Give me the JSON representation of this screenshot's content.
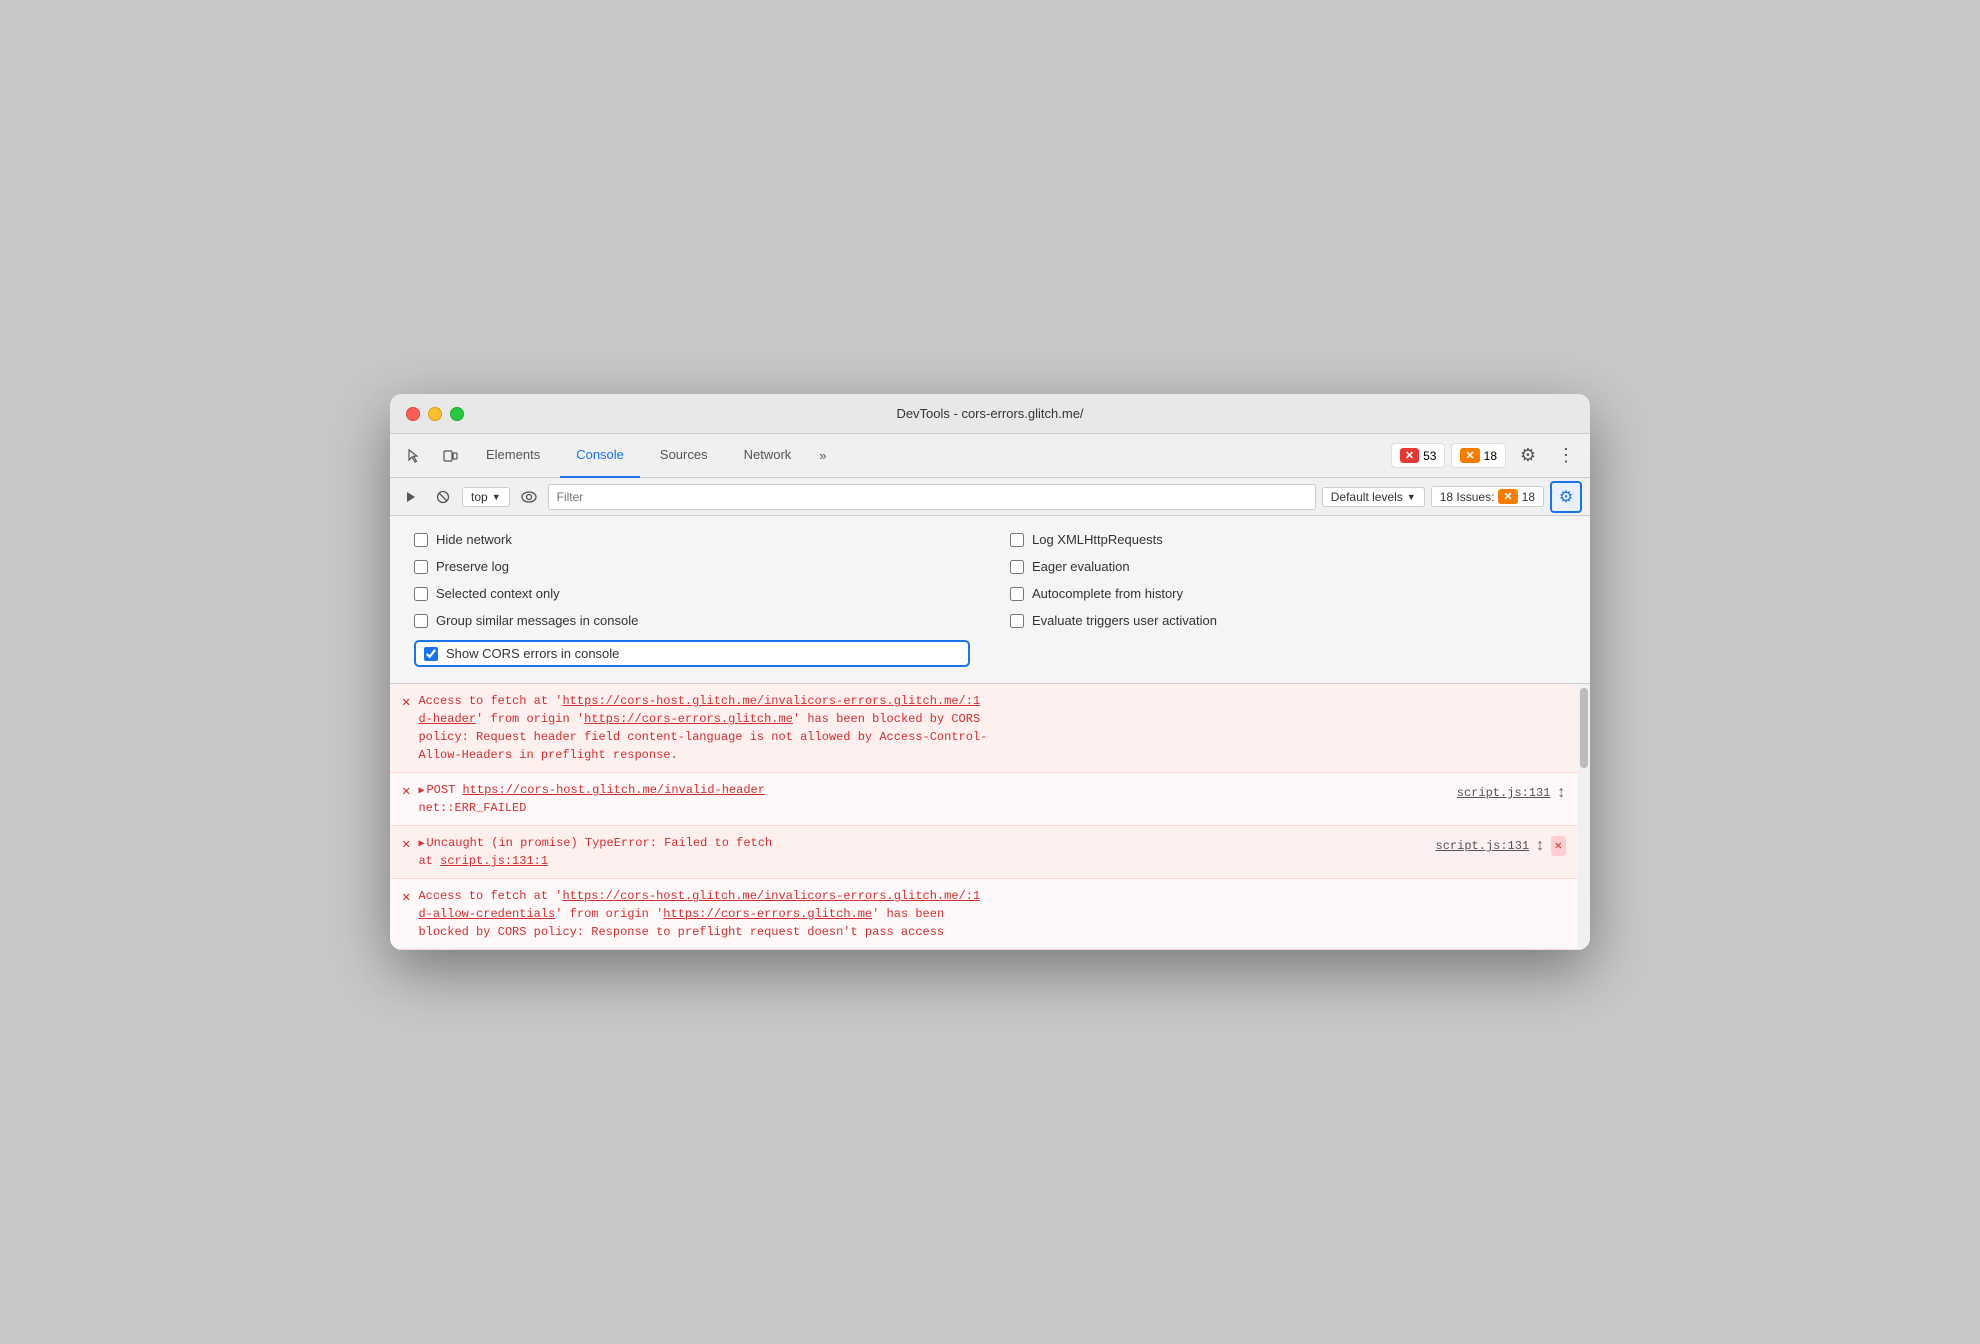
{
  "window": {
    "title": "DevTools - cors-errors.glitch.me/"
  },
  "toolbar": {
    "tabs": [
      {
        "id": "elements",
        "label": "Elements",
        "active": false
      },
      {
        "id": "console",
        "label": "Console",
        "active": true
      },
      {
        "id": "sources",
        "label": "Sources",
        "active": false
      },
      {
        "id": "network",
        "label": "Network",
        "active": false
      }
    ],
    "more_label": "»",
    "error_count": "53",
    "warning_count": "18"
  },
  "console_toolbar": {
    "top_label": "top",
    "filter_placeholder": "Filter",
    "default_levels_label": "Default levels",
    "issues_label": "18 Issues:",
    "issues_count": "18"
  },
  "settings_panel": {
    "checkboxes_left": [
      {
        "id": "hide-network",
        "label": "Hide network",
        "checked": false
      },
      {
        "id": "preserve-log",
        "label": "Preserve log",
        "checked": false
      },
      {
        "id": "selected-context",
        "label": "Selected context only",
        "checked": false
      },
      {
        "id": "group-similar",
        "label": "Group similar messages in console",
        "checked": false
      },
      {
        "id": "show-cors",
        "label": "Show CORS errors in console",
        "checked": true,
        "highlighted": true
      }
    ],
    "checkboxes_right": [
      {
        "id": "log-xmlhttp",
        "label": "Log XMLHttpRequests",
        "checked": false
      },
      {
        "id": "eager-eval",
        "label": "Eager evaluation",
        "checked": false
      },
      {
        "id": "autocomplete",
        "label": "Autocomplete from history",
        "checked": false
      },
      {
        "id": "evaluate-triggers",
        "label": "Evaluate triggers user activation",
        "checked": false
      }
    ]
  },
  "errors": [
    {
      "id": "error1",
      "type": "error",
      "bg": "light-red",
      "text_parts": [
        "Access to fetch at '",
        "https://cors-host.glitch.me/invali",
        "cors-errors.glitch.me/:1",
        "d-header",
        "' from origin '",
        "https://cors-errors.glitch.me",
        "' has been blocked by CORS policy: Request header field content-language is not allowed by Access-Control-Allow-Headers in preflight response."
      ],
      "full_text": "Access to fetch at 'https://cors-host.glitch.me/invalid-header' from origin 'https://cors-errors.glitch.me' has been blocked by CORS policy: Request header field content-language is not allowed by Access-Control-Allow-Headers in preflight response."
    },
    {
      "id": "error2",
      "type": "error",
      "bg": "white",
      "prefix": "▶ POST ",
      "url": "https://cors-host.glitch.me/invalid-header",
      "sub_text": "net::ERR_FAILED",
      "file": "script.js:131",
      "has_scroll": true,
      "has_close": false
    },
    {
      "id": "error3",
      "type": "error",
      "bg": "light-red",
      "prefix": "▶ Uncaught (in promise) TypeError: Failed to fetch",
      "sub_text": "at script.js:131:1",
      "file": "script.js:131",
      "has_scroll": true,
      "has_close": true
    },
    {
      "id": "error4",
      "type": "error",
      "bg": "white",
      "full_text": "Access to fetch at 'https://cors-host.glitch.me/invalid-allow-credentials' from origin 'https://cors-errors.glitch.me' has been blocked by CORS policy: Response to preflight request doesn't pass access"
    }
  ]
}
